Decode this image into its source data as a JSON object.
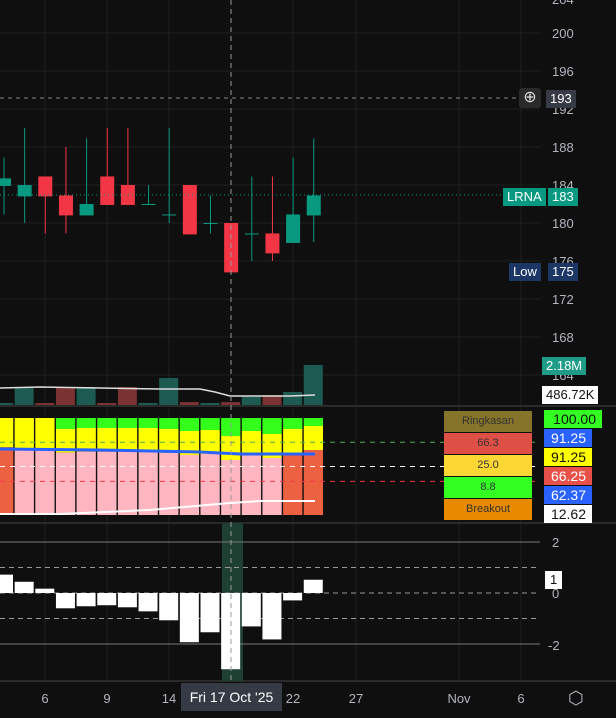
{
  "colors": {
    "up": "#089981",
    "down": "#f23645",
    "bg": "#0f0f0f"
  },
  "price_axis": {
    "labels": [
      "204",
      "200",
      "196",
      "192",
      "188",
      "184",
      "180",
      "176",
      "172",
      "168",
      "164"
    ]
  },
  "badges": {
    "crosshair_price": "193",
    "symbol": "LRNA",
    "last_price": "183",
    "low_label": "Low",
    "low_price": "175",
    "volume": "2.18M",
    "volume_ma": "486.72K"
  },
  "candles": [
    {
      "o": 183.9,
      "h": 186.9,
      "l": 180.9,
      "c": 184.7,
      "v": 0.11
    },
    {
      "o": 182.8,
      "h": 190.0,
      "l": 180.0,
      "c": 184.0,
      "v": 0.96
    },
    {
      "o": 184.9,
      "h": 184.9,
      "l": 178.9,
      "c": 182.8,
      "v": 0.11
    },
    {
      "o": 182.9,
      "h": 188.0,
      "l": 178.9,
      "c": 180.8,
      "v": 0.98
    },
    {
      "o": 180.8,
      "h": 188.9,
      "l": 180.8,
      "c": 182.0,
      "v": 0.98
    },
    {
      "o": 184.9,
      "h": 190.0,
      "l": 181.9,
      "c": 181.9,
      "v": 0.11
    },
    {
      "o": 184.0,
      "h": 190.0,
      "l": 181.9,
      "c": 181.9,
      "v": 0.98
    },
    {
      "o": 182.0,
      "h": 184.0,
      "l": 182.0,
      "c": 182.0,
      "v": 0.11
    },
    {
      "o": 180.9,
      "h": 190.0,
      "l": 180.0,
      "c": 180.9,
      "v": 1.47
    },
    {
      "o": 184.0,
      "h": 184.0,
      "l": 178.8,
      "c": 178.8,
      "v": 0.16
    },
    {
      "o": 180.0,
      "h": 182.9,
      "l": 178.9,
      "c": 180.0,
      "v": 0.11
    },
    {
      "o": 180.0,
      "h": 180.0,
      "l": 174.8,
      "c": 174.8,
      "v": 0.16
    },
    {
      "o": 178.9,
      "h": 184.9,
      "l": 176.0,
      "c": 178.9,
      "v": 0.45
    },
    {
      "o": 178.9,
      "h": 184.9,
      "l": 176.0,
      "c": 176.8,
      "v": 0.54
    },
    {
      "o": 177.9,
      "h": 186.9,
      "l": 177.9,
      "c": 180.9,
      "v": 0.71
    },
    {
      "o": 180.8,
      "h": 188.9,
      "l": 178.0,
      "c": 182.9,
      "v": 2.18
    }
  ],
  "stack": [
    {
      "g": 100,
      "y": 69.8,
      "b": "orange"
    },
    {
      "g": 100,
      "y": 67,
      "b": "pink"
    },
    {
      "g": 100,
      "y": 67,
      "b": "pink"
    },
    {
      "g": 88.7,
      "y": 64.3,
      "b": "pink"
    },
    {
      "g": 89.7,
      "y": 65.3,
      "b": "pink"
    },
    {
      "g": 89.7,
      "y": 65.3,
      "b": "pink"
    },
    {
      "g": 89.7,
      "y": 65.3,
      "b": "pink"
    },
    {
      "g": 89.7,
      "y": 65.3,
      "b": "pink"
    },
    {
      "g": 88.7,
      "y": 64.3,
      "b": "pink"
    },
    {
      "g": 86.6,
      "y": 61.9,
      "b": "pink"
    },
    {
      "g": 87.6,
      "y": 62.9,
      "b": "pink"
    },
    {
      "g": 81.4,
      "y": 56.7,
      "b": "pink"
    },
    {
      "g": 86.6,
      "y": 61.9,
      "b": "pink"
    },
    {
      "g": 83.5,
      "y": 58.8,
      "b": "pink"
    },
    {
      "g": 88.7,
      "y": 63.9,
      "b": "orange"
    },
    {
      "g": 91.8,
      "y": 67,
      "b": "orange"
    }
  ],
  "summary": {
    "title": "Ringkasan",
    "red": "66.3",
    "yellow": "25.0",
    "green": "8.8",
    "footer": "Breakout"
  },
  "right_values": [
    "100.00",
    "91.25",
    "91.25",
    "66.25",
    "62.37",
    "12.62"
  ],
  "histogram": [
    0.72,
    0.44,
    0.17,
    -0.6,
    -0.52,
    -0.48,
    -0.56,
    -0.72,
    -1.07,
    -1.93,
    -1.54,
    -2.99,
    -1.31,
    -1.82,
    -0.29,
    0.52
  ],
  "osc_axis": {
    "labels": [
      "2",
      "0",
      "-2"
    ],
    "current": "1"
  },
  "time_axis": {
    "labels": [
      "6",
      "9",
      "14",
      "22",
      "27",
      "Nov",
      "6"
    ],
    "crosshair": "Fri 17 Oct '25"
  }
}
